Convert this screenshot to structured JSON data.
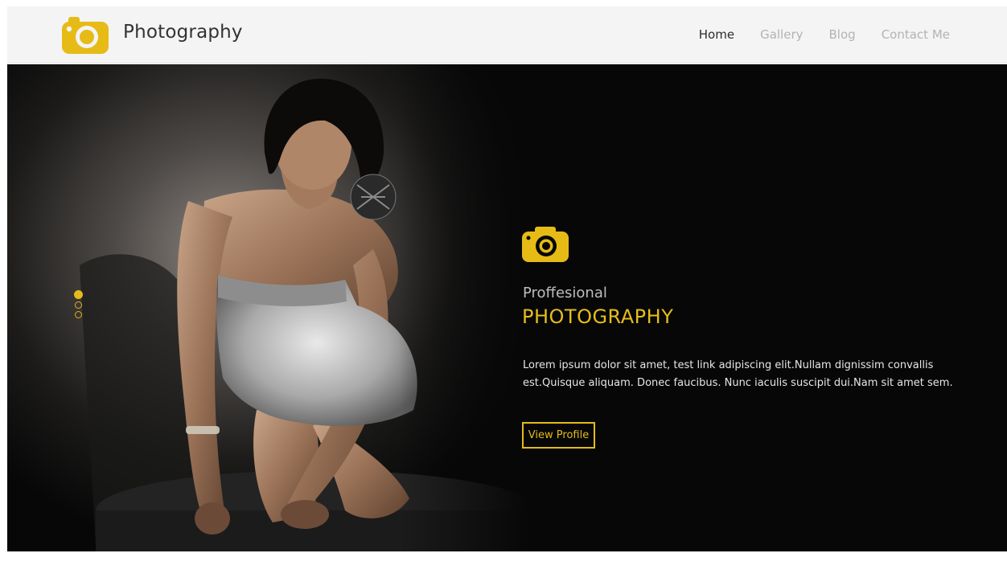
{
  "header": {
    "brand": "Photography",
    "logo_icon": "camera-icon",
    "nav": [
      {
        "label": "Home",
        "active": true
      },
      {
        "label": "Gallery",
        "active": false
      },
      {
        "label": "Blog",
        "active": false
      },
      {
        "label": "Contact Me",
        "active": false
      }
    ]
  },
  "hero": {
    "icon": "camera-icon",
    "subtitle": "Proffesional",
    "title": "PHOTOGRAPHY",
    "description": "Lorem ipsum dolor sit amet, test link adipiscing elit.Nullam dignissim convallis est.Quisque aliquam. Donec faucibus. Nunc iaculis suscipit dui.Nam sit amet sem.",
    "button_label": "View Profile",
    "slider_dots": 3,
    "active_slide": 1
  },
  "colors": {
    "accent": "#e2bb1c",
    "hero_background": "#070707",
    "header_background": "#f4f4f4"
  }
}
